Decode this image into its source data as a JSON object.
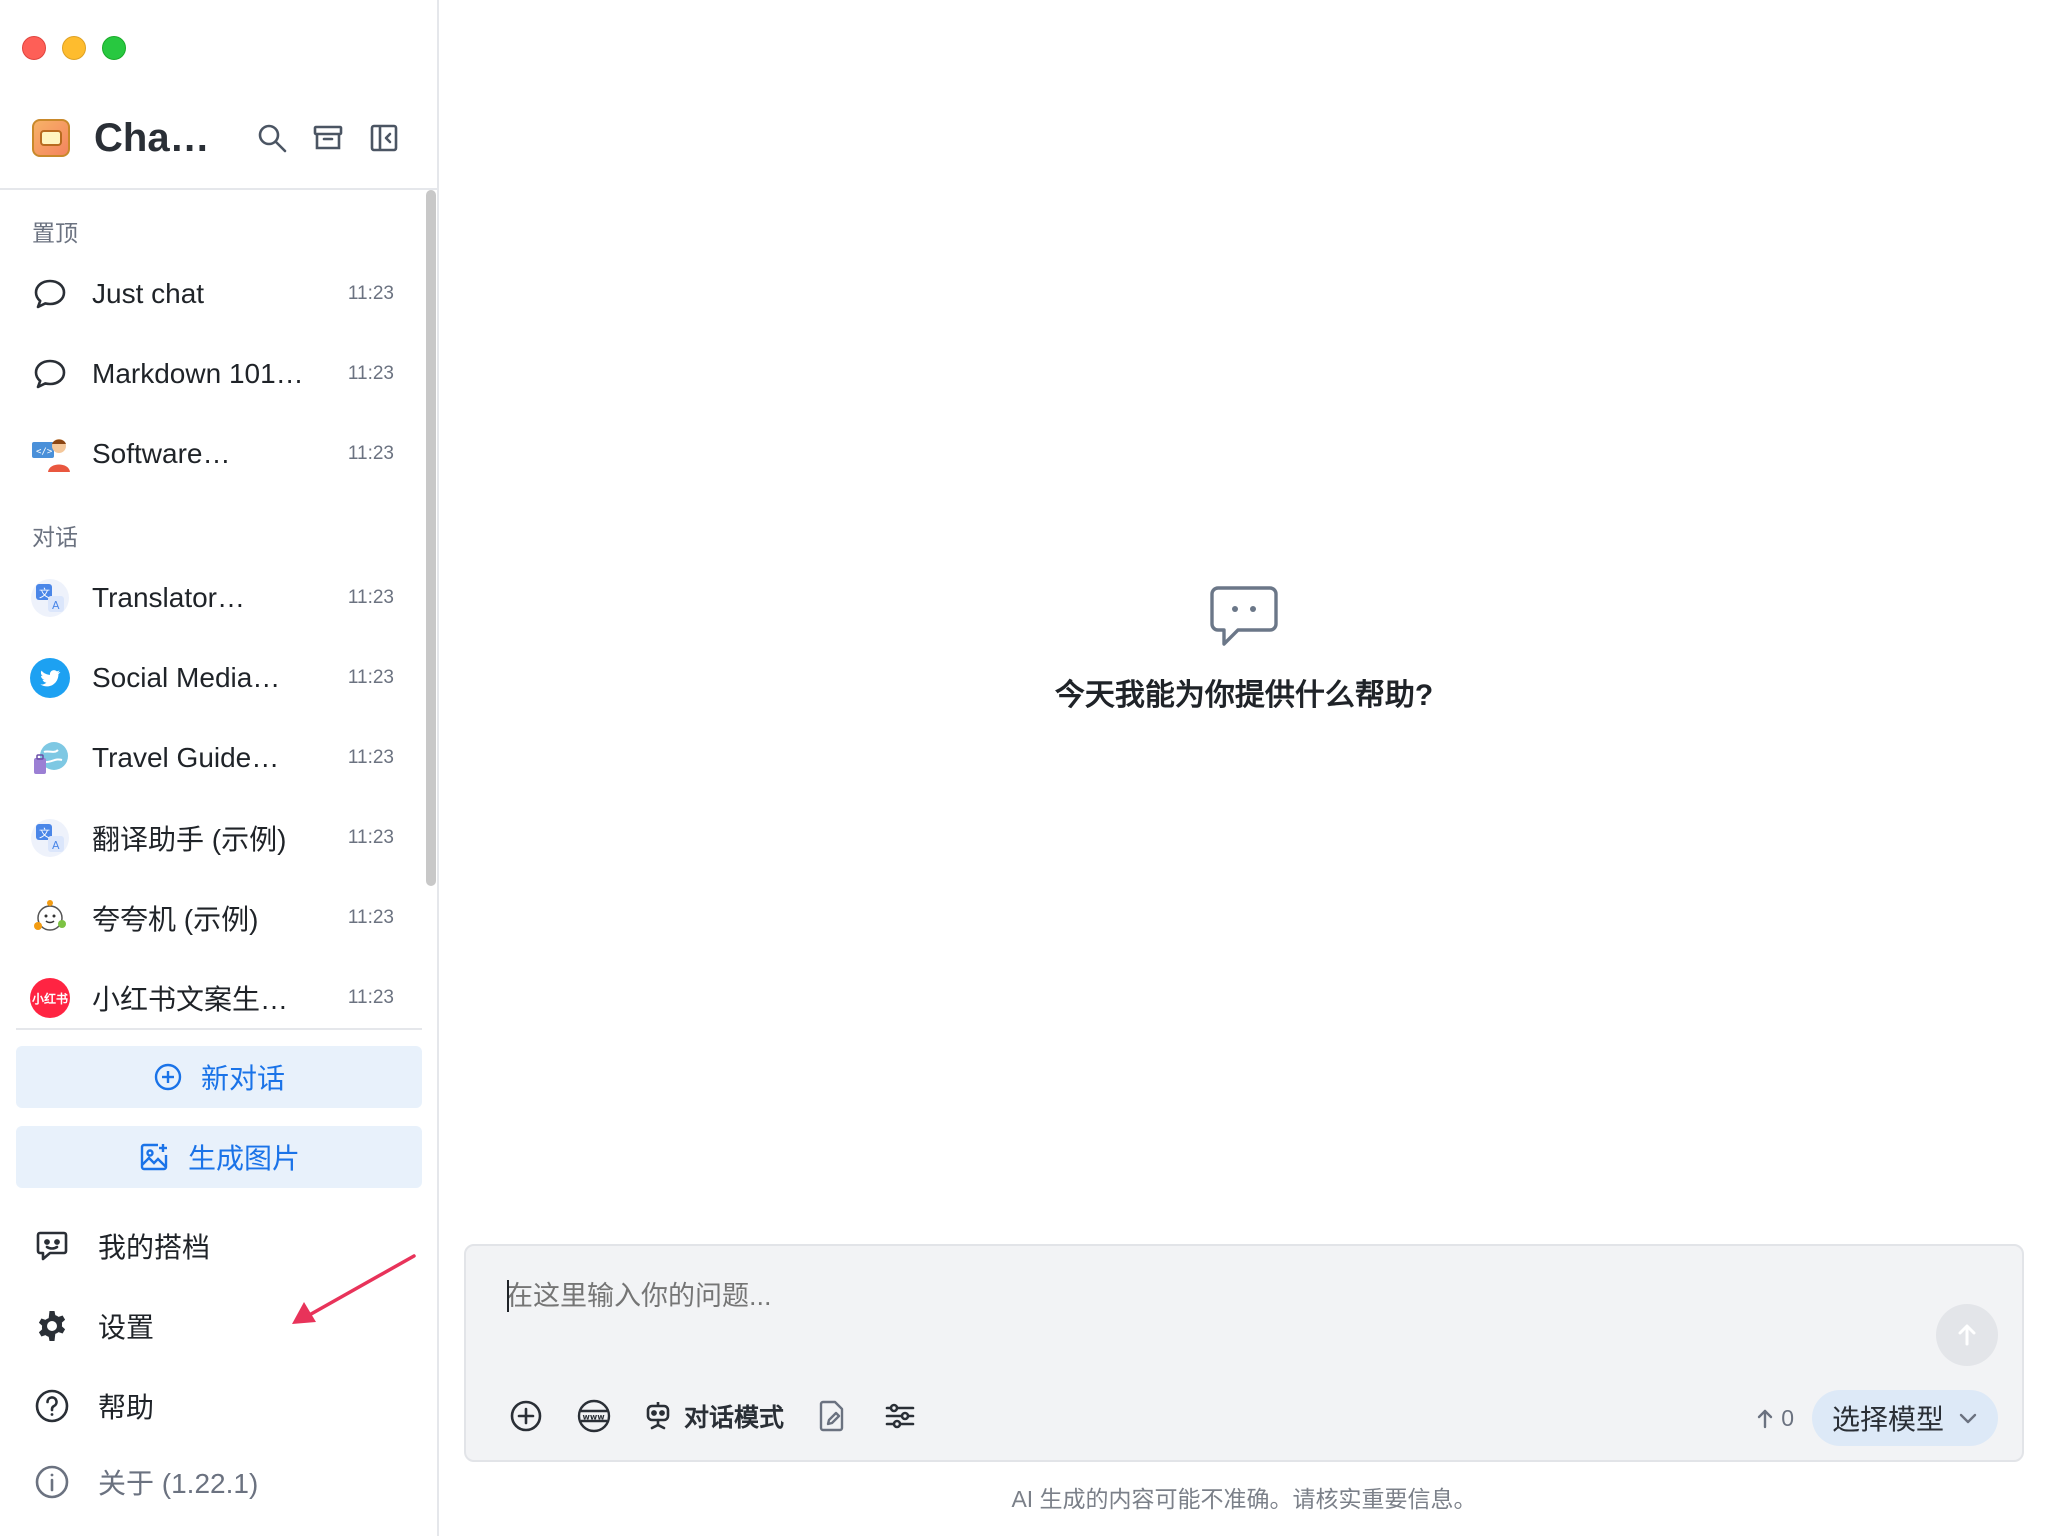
{
  "app": {
    "title": "Cha…",
    "brand_color": "#1a73e8"
  },
  "sidebar": {
    "header_actions": [
      "search-icon",
      "archive-icon",
      "collapse-sidebar-icon"
    ],
    "pinned_label": "置顶",
    "pinned": [
      {
        "title": "Just chat",
        "time": "11:23",
        "icon": "chat-bubble-icon"
      },
      {
        "title": "Markdown 101…",
        "time": "11:23",
        "icon": "chat-bubble-icon"
      },
      {
        "title": "Software…",
        "time": "11:23",
        "icon": "developer-avatar"
      }
    ],
    "conversations_label": "对话",
    "conversations": [
      {
        "title": "Translator…",
        "time": "11:23",
        "icon": "translate-avatar"
      },
      {
        "title": "Social Media…",
        "time": "11:23",
        "icon": "twitter-avatar"
      },
      {
        "title": "Travel Guide…",
        "time": "11:23",
        "icon": "travel-avatar"
      },
      {
        "title": "翻译助手 (示例)",
        "time": "11:23",
        "icon": "translate-avatar"
      },
      {
        "title": "夸夸机 (示例)",
        "time": "11:23",
        "icon": "praise-avatar"
      },
      {
        "title": "小红书文案生成…",
        "time": "11:23",
        "icon": "xiaohongshu-avatar",
        "avatar_text": "小红书"
      }
    ],
    "new_chat_label": "新对话",
    "generate_image_label": "生成图片",
    "footer": {
      "partners_label": "我的搭档",
      "settings_label": "设置",
      "help_label": "帮助",
      "about_label": "关于 (1.22.1)"
    }
  },
  "main": {
    "empty_title": "今天我能为你提供什么帮助?",
    "composer": {
      "placeholder": "在这里输入你的问题...",
      "mode_label": "对话模式",
      "token_count": "0",
      "model_label": "选择模型"
    },
    "disclaimer": "AI 生成的内容可能不准确。请核实重要信息。"
  }
}
